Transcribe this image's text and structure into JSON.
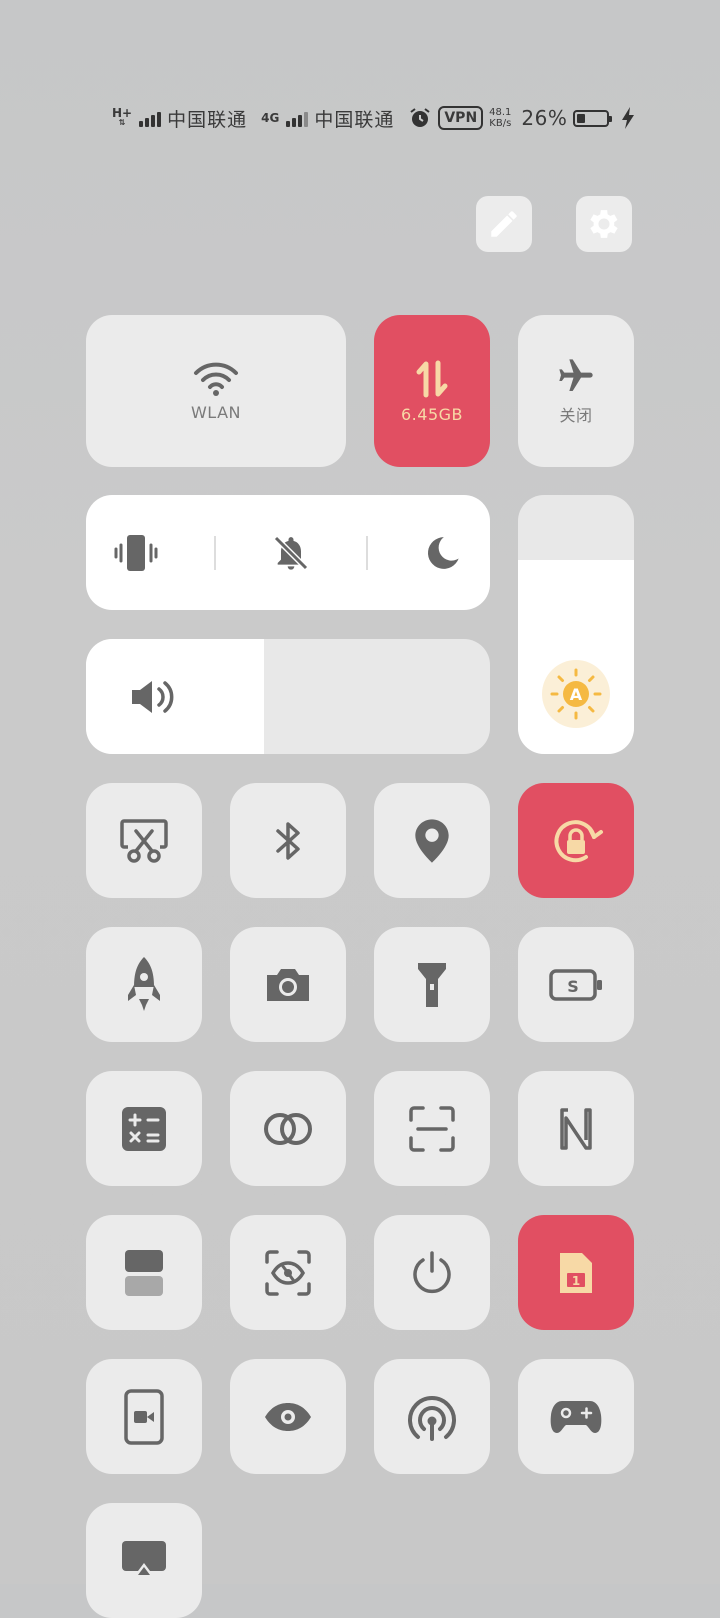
{
  "status_bar": {
    "net1": "H+",
    "carrier1": "中国联通",
    "net2": "4G",
    "carrier2": "中国联通",
    "vpn": "VPN",
    "speed_value": "48.1",
    "speed_unit": "KB/s",
    "battery_text": "26%",
    "battery_level": 0.26
  },
  "tiles": {
    "wlan_label": "WLAN",
    "data_label": "6.45GB",
    "airplane_label": "关闭"
  },
  "sliders": {
    "volume_level": 0.44,
    "brightness_level": 0.75
  },
  "colors": {
    "active": "#e14f62",
    "tile": "#ebebeb",
    "icon": "#6a6a6a",
    "brightness_accent": "#f5b942"
  }
}
